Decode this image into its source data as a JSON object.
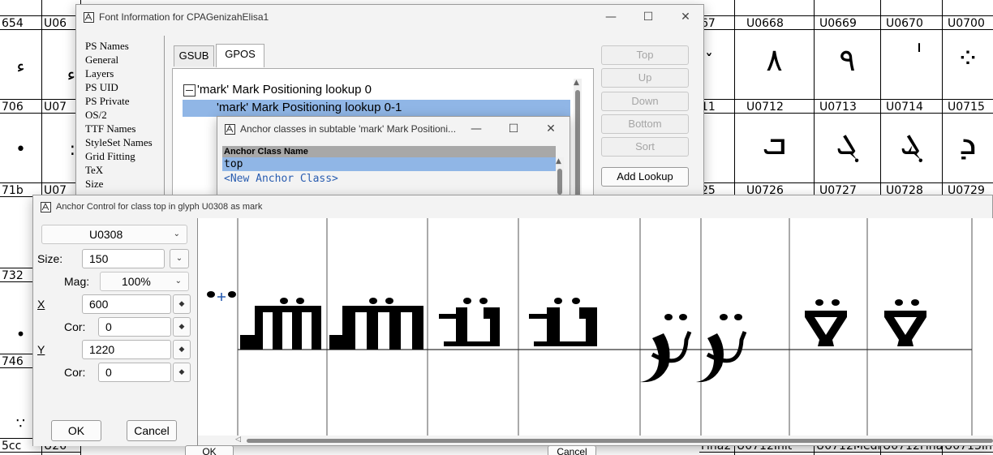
{
  "glyph_grid": {
    "columns": [
      {
        "labels": [
          "654",
          "706",
          "71b",
          "732",
          "746",
          "5cc"
        ]
      },
      {
        "labels": [
          "U06",
          "U07",
          "U07",
          "",
          "",
          "U26"
        ]
      },
      {
        "labels": [
          "67",
          "11",
          "25",
          "",
          "",
          "Fina2"
        ]
      },
      {
        "labels": [
          "U0668",
          "U0712",
          "U0726",
          "",
          "",
          "U0712Init"
        ]
      },
      {
        "labels": [
          "U0669",
          "U0713",
          "U0727",
          "",
          "",
          "U0712Medi"
        ]
      },
      {
        "labels": [
          "U0670",
          "U0714",
          "U0728",
          "",
          "",
          "U0712Fina"
        ]
      },
      {
        "labels": [
          "U0700",
          "U0715",
          "U0729",
          "",
          "",
          "U0713In"
        ]
      }
    ],
    "row_glyphs": {
      "U0668": "٨",
      "U0669": "٩",
      "U0670": "ٰ",
      "U0700": "⁘",
      "U0712": "ܒ",
      "U0713": "ܓ",
      "U0714": "ܔ",
      "U0715": "ܕ"
    }
  },
  "font_info": {
    "title": "Font Information for CPAGenizahElisa1",
    "categories": [
      "PS Names",
      "General",
      "Layers",
      "PS UID",
      "PS Private",
      "OS/2",
      "TTF Names",
      "StyleSet Names",
      "Grid Fitting",
      "TeX",
      "Size"
    ],
    "tabs": [
      "GSUB",
      "GPOS"
    ],
    "active_tab": "GPOS",
    "lookup": "'mark' Mark Positioning lookup 0",
    "subtable": "'mark' Mark Positioning lookup 0-1",
    "buttons": [
      "Top",
      "Up",
      "Down",
      "Bottom",
      "Sort",
      "Add Lookup"
    ],
    "enabled_button": "Add Lookup"
  },
  "anchor_classes": {
    "title": "Anchor classes in subtable 'mark' Mark Positioni...",
    "column_header": "Anchor Class Name",
    "rows": [
      "top",
      "<New Anchor Class>"
    ],
    "selected_row": "top"
  },
  "anchor_control": {
    "title": "Anchor Control for class top in glyph U0308 as mark",
    "glyph_select": "U0308",
    "size_label": "Size:",
    "size_value": "150",
    "mag_label": "Mag:",
    "mag_value": "100%",
    "x_label": "X",
    "x_value": "600",
    "x_cor_label": "Cor:",
    "x_cor_value": "0",
    "y_label": "Y",
    "y_value": "1220",
    "y_cor_label": "Cor:",
    "y_cor_value": "0",
    "ok_label": "OK",
    "cancel_label": "Cancel"
  },
  "bottom_buttons": {
    "ok": "OK",
    "cancel": "Cancel"
  },
  "colors": {
    "selection": "#90b6e6",
    "glyph": "#000000",
    "anchor_point": "#2a5db0"
  }
}
